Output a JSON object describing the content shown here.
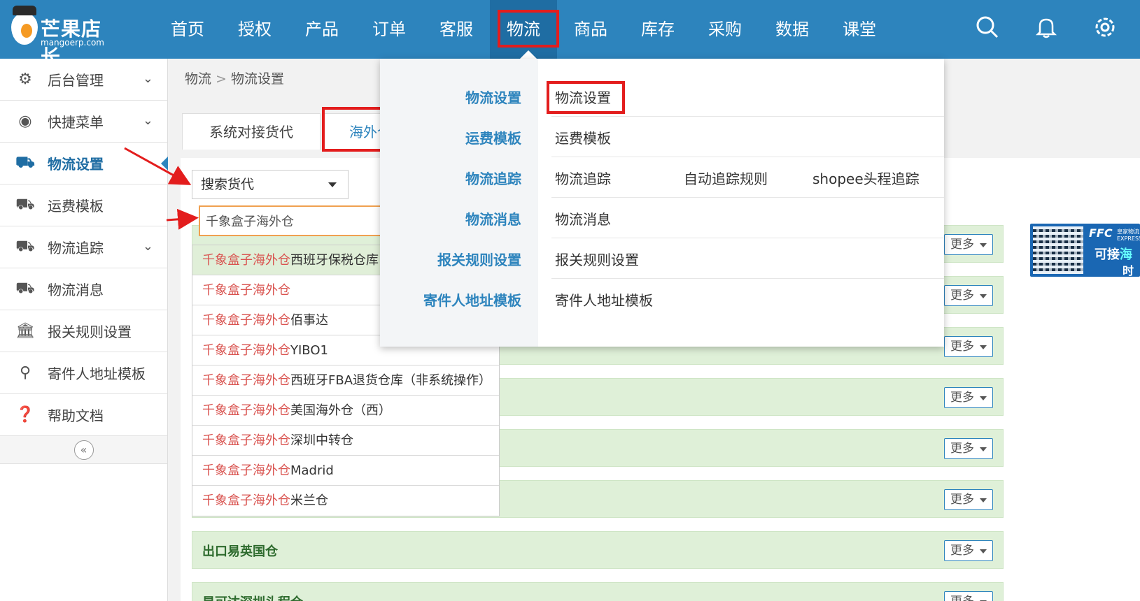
{
  "logo": {
    "cn": "芒果店长",
    "en": "mangoerp.com"
  },
  "nav": [
    "首页",
    "授权",
    "产品",
    "订单",
    "客服",
    "物流",
    "商品",
    "库存",
    "采购",
    "数据",
    "课堂"
  ],
  "sidebar": [
    {
      "label": "后台管理",
      "icon": "gear-icon",
      "glyph": "⚙",
      "chevron": true
    },
    {
      "label": "快捷菜单",
      "icon": "shortcut-icon",
      "glyph": "◉",
      "chevron": true
    },
    {
      "label": "物流设置",
      "icon": "truck-icon",
      "glyph": "⛟",
      "chevron": false,
      "active": true
    },
    {
      "label": "运费模板",
      "icon": "truck-icon",
      "glyph": "⛟",
      "chevron": false
    },
    {
      "label": "物流追踪",
      "icon": "truck-icon",
      "glyph": "⛟",
      "chevron": true
    },
    {
      "label": "物流消息",
      "icon": "truck-icon",
      "glyph": "⛟",
      "chevron": false
    },
    {
      "label": "报关规则设置",
      "icon": "bank-icon",
      "glyph": "🏛",
      "chevron": false
    },
    {
      "label": "寄件人地址模板",
      "icon": "location-pin-icon",
      "glyph": "⚲",
      "chevron": false
    },
    {
      "label": "帮助文档",
      "icon": "help-icon",
      "glyph": "❓",
      "chevron": false
    }
  ],
  "collapse_glyph": "«",
  "breadcrumb": {
    "root": "物流",
    "sep": ">",
    "current": "物流设置"
  },
  "tabs": [
    "系统对接货代",
    "海外仓"
  ],
  "search": {
    "select_label": "搜索货代",
    "input_value": "千象盒子海外仓"
  },
  "dropdown": {
    "highlight": "千象盒子海外仓",
    "items": [
      "西班牙保税仓库",
      "",
      "佰事达",
      "YIBO1",
      "西班牙FBA退货仓库（非系统操作）",
      "美国海外仓（西）",
      "深圳中转仓",
      "Madrid",
      "米兰仓"
    ]
  },
  "rows": [
    {
      "name": "",
      "more": "更多"
    },
    {
      "name": "",
      "more": "更多"
    },
    {
      "name": "",
      "more": "更多"
    },
    {
      "name": "",
      "more": "更多"
    },
    {
      "name": "",
      "more": "更多"
    },
    {
      "name": "",
      "more": "更多"
    },
    {
      "name": "出口易英国仓",
      "more": "更多"
    },
    {
      "name": "星可达深圳头程仓",
      "more": "更多"
    }
  ],
  "ad": {
    "brand": "FFC",
    "brand_sub": "皇家物流 EXPRESS",
    "line1_a": "可接",
    "line1_b": "海",
    "line2": "时"
  },
  "mega_menu": {
    "categories": [
      "物流设置",
      "运费模板",
      "物流追踪",
      "物流消息",
      "报关规则设置",
      "寄件人地址模板"
    ],
    "items": [
      [
        "物流设置"
      ],
      [
        "运费模板"
      ],
      [
        "物流追踪",
        "自动追踪规则",
        "shopee头程追踪"
      ],
      [
        "物流消息"
      ],
      [
        "报关规则设置"
      ],
      [
        "寄件人地址模板"
      ]
    ]
  },
  "colors": {
    "topbar": "#2d84bd",
    "accent": "#2d84bd",
    "highlight_box": "#e31d1d",
    "row_bg": "#dff0d8",
    "match_text": "#d9534f"
  }
}
